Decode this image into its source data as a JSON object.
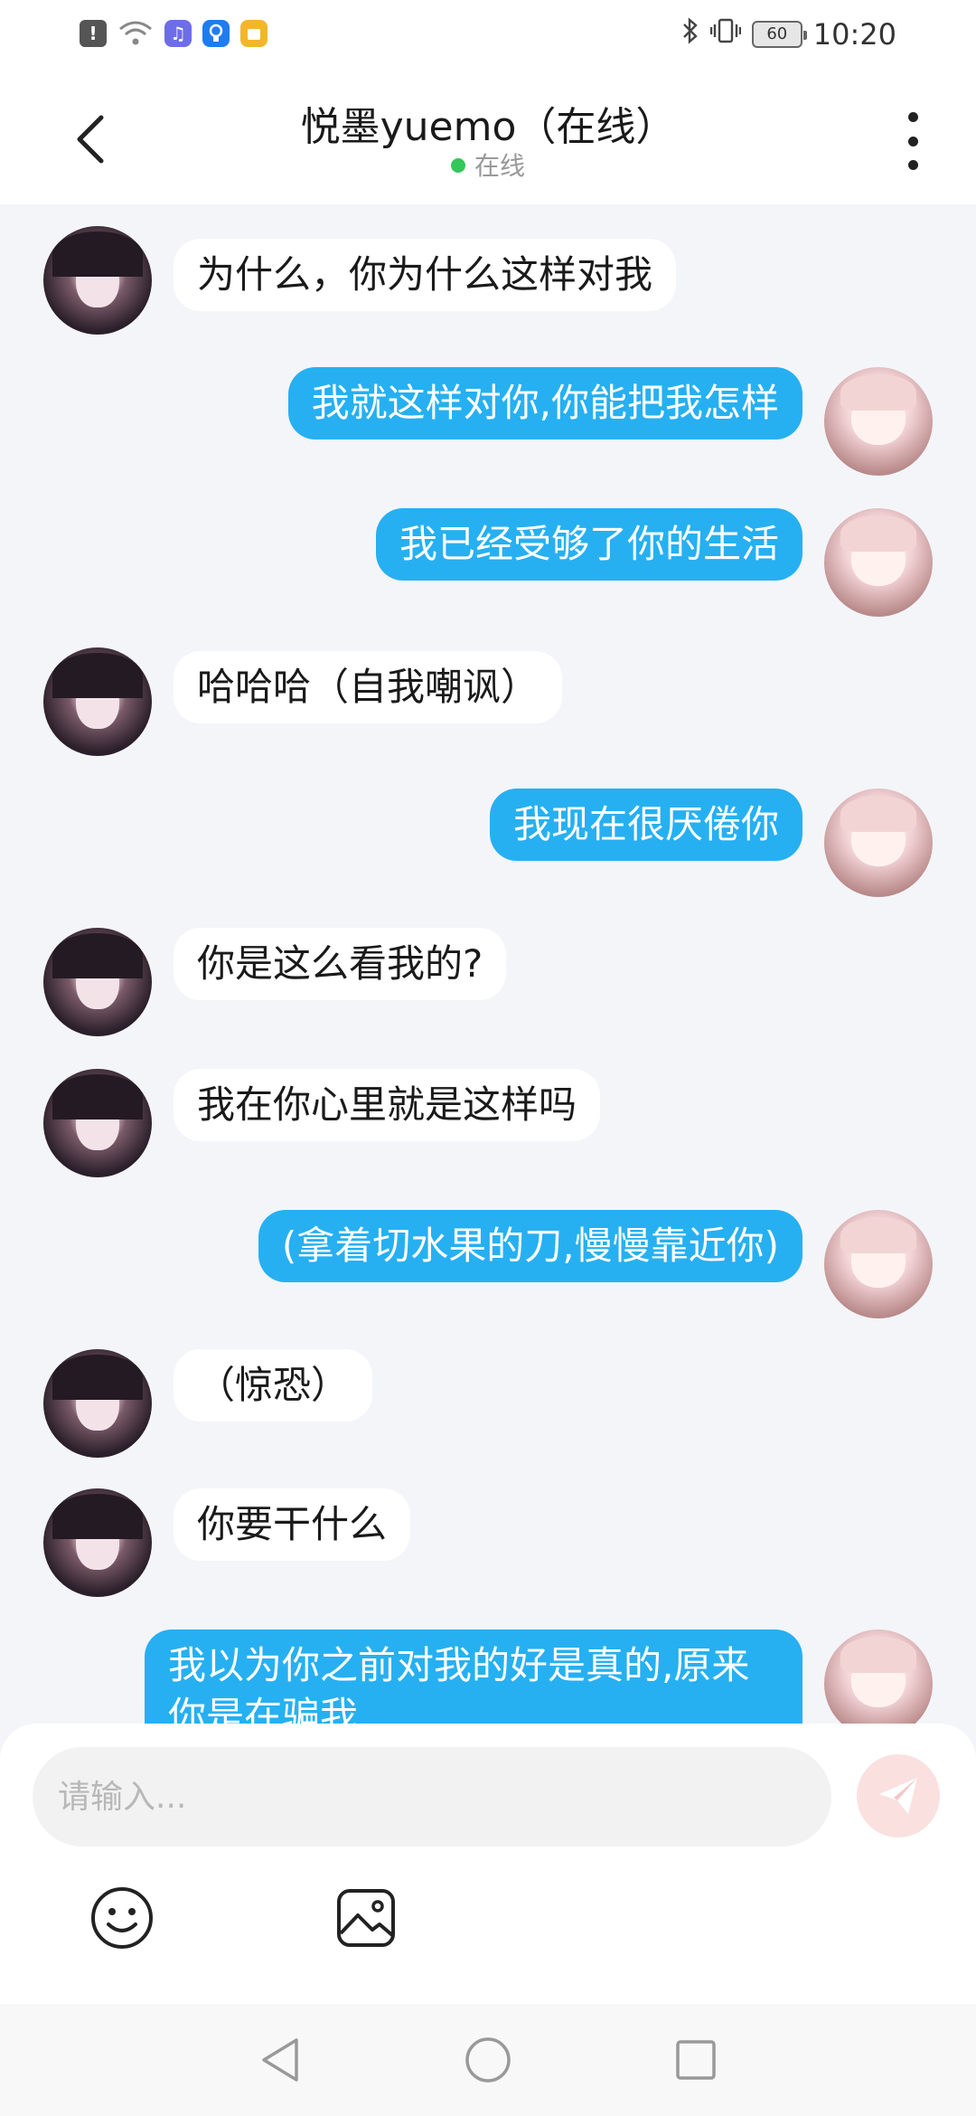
{
  "status_bar": {
    "time": "10:20",
    "battery_level": "60",
    "icons": [
      "alert-icon",
      "wifi-icon",
      "music-app-icon",
      "bulb-app-icon",
      "notes-app-icon",
      "bluetooth-icon",
      "vibrate-icon",
      "battery-icon"
    ]
  },
  "header": {
    "title": "悦墨yuemo（在线）",
    "status": "在线",
    "status_color": "#34c759"
  },
  "messages": [
    {
      "from": "other",
      "text": "为什么，你为什么这样对我"
    },
    {
      "from": "me",
      "text": "我就这样对你,你能把我怎样"
    },
    {
      "from": "me",
      "text": "我已经受够了你的生活"
    },
    {
      "from": "other",
      "text": "哈哈哈（自我嘲讽）"
    },
    {
      "from": "me",
      "text": "我现在很厌倦你"
    },
    {
      "from": "other",
      "text": "你是这么看我的?"
    },
    {
      "from": "other",
      "text": "我在你心里就是这样吗"
    },
    {
      "from": "me",
      "text": "(拿着切水果的刀,慢慢靠近你)"
    },
    {
      "from": "other",
      "text": "（惊恐）"
    },
    {
      "from": "other",
      "text": "你要干什么"
    },
    {
      "from": "me",
      "text": "我以为你之前对我的好是真的,原来你是在骗我"
    }
  ],
  "input": {
    "placeholder": "请输入..."
  },
  "colors": {
    "outgoing_bubble": "#26b0f1",
    "incoming_bubble": "#ffffff",
    "background": "#f4f5f9"
  }
}
